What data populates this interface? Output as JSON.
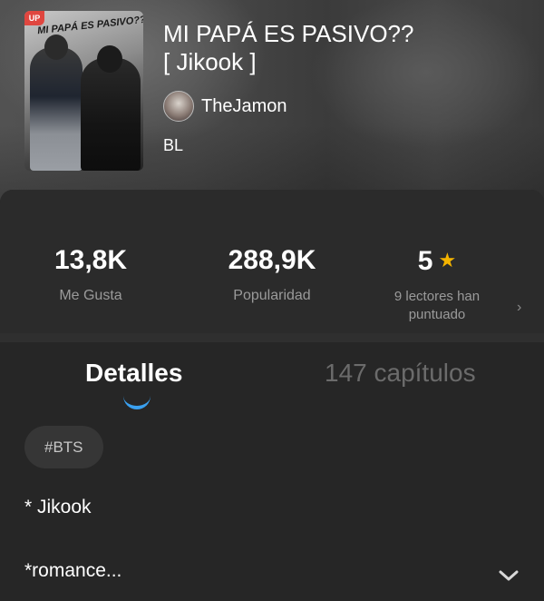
{
  "book": {
    "badge": "UP",
    "cover_text": "MI PAPÁ ES PASIVO??",
    "title": "MI PAPÁ ES PASIVO?? [ Jikook ]",
    "title_line1": "MI PAPÁ ES PASIVO??",
    "title_line2": "[ Jikook ]",
    "author": "TheJamon",
    "genre": "BL"
  },
  "stats": {
    "likes_value": "13,8K",
    "likes_label": "Me Gusta",
    "popularity_value": "288,9K",
    "popularity_label": "Popularidad",
    "rating_value": "5",
    "rating_label_line1": "9 lectores han",
    "rating_label_line2": "puntuado"
  },
  "tabs": {
    "details": "Detalles",
    "chapters": "147 capítulos",
    "active": "details"
  },
  "details": {
    "tag": "#BTS",
    "line1": "* Jikook",
    "line2": "*romance..."
  },
  "icons": {
    "rating": "star-icon",
    "more": "chevron-right-icon",
    "expand": "chevron-down-icon"
  },
  "colors": {
    "accent": "#3aa0ef",
    "star": "#f5b400",
    "badge": "#e0463f"
  }
}
